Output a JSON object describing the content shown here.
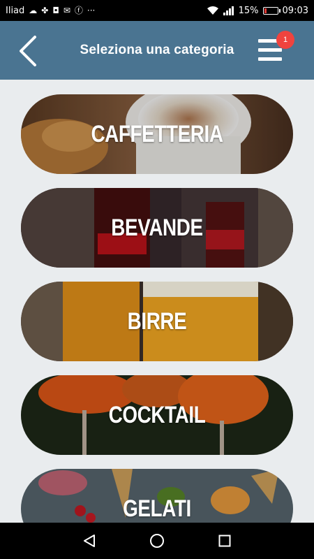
{
  "status_bar": {
    "carrier": "Iliad",
    "battery": "15%",
    "battery_level": 0.15,
    "time": "09:03"
  },
  "header": {
    "title": "Seleziona una categoria",
    "notification_count": "1"
  },
  "categories": [
    {
      "label": "CAFFETTERIA"
    },
    {
      "label": "BEVANDE"
    },
    {
      "label": "BIRRE"
    },
    {
      "label": "COCKTAIL"
    },
    {
      "label": "GELATI"
    }
  ],
  "colors": {
    "header_bg": "#4a7491",
    "page_bg": "#e9ecee",
    "badge": "#f0433e"
  }
}
